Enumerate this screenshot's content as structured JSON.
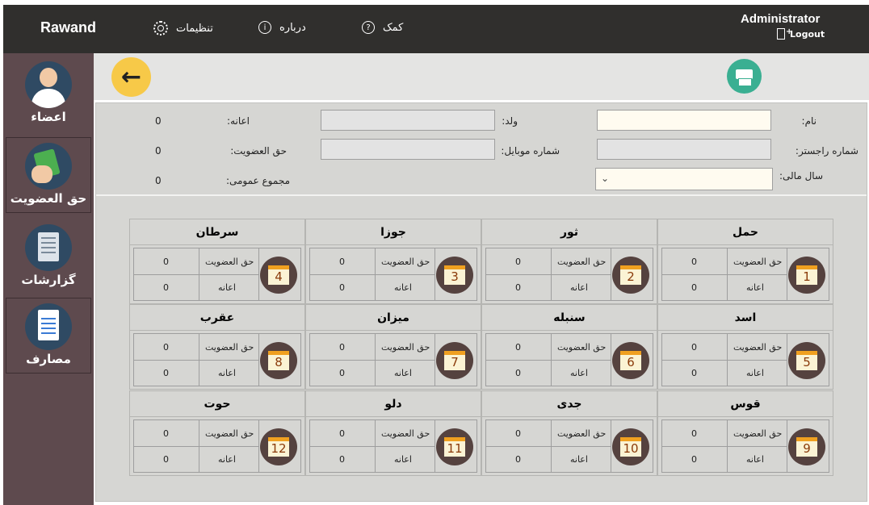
{
  "header": {
    "brand": "Rawand",
    "nav": [
      {
        "label": "تنظیمات",
        "icon": "gear-icon"
      },
      {
        "label": "درباره",
        "icon": "info-icon"
      },
      {
        "label": "کمک",
        "icon": "help-icon"
      }
    ],
    "user": "Administrator",
    "logout": "Logout"
  },
  "sidebar": {
    "items": [
      {
        "label": "اعضاء",
        "icon": "member-avatar-icon"
      },
      {
        "label": "حق العضویت",
        "icon": "money-hand-icon"
      },
      {
        "label": "گزارشات",
        "icon": "report-book-icon"
      },
      {
        "label": "مصارف",
        "icon": "expense-checklist-icon"
      }
    ]
  },
  "form": {
    "name_label": "نام:",
    "father_label": "ولد:",
    "donation_label": "اعانه:",
    "donation_value": "0",
    "reg_no_label": "شماره راجستر:",
    "mobile_label": "شماره موبایل:",
    "membership_label": "حق العضویت:",
    "membership_value": "0",
    "fiscal_year_label": "سال مالی:",
    "total_label": "مجموع عمومی:",
    "total_value": "0"
  },
  "months": [
    {
      "name": "حمل",
      "number": "1",
      "membership_label": "حق العضویت",
      "membership": "0",
      "donation_label": "اعانه",
      "donation": "0"
    },
    {
      "name": "ثور",
      "number": "2",
      "membership_label": "حق العضویت",
      "membership": "0",
      "donation_label": "اعانه",
      "donation": "0"
    },
    {
      "name": "جوزا",
      "number": "3",
      "membership_label": "حق العضویت",
      "membership": "0",
      "donation_label": "اعانه",
      "donation": "0"
    },
    {
      "name": "سرطان",
      "number": "4",
      "membership_label": "حق العضویت",
      "membership": "0",
      "donation_label": "اعانه",
      "donation": "0"
    },
    {
      "name": "اسد",
      "number": "5",
      "membership_label": "حق العضویت",
      "membership": "0",
      "donation_label": "اعانه",
      "donation": "0"
    },
    {
      "name": "سنبله",
      "number": "6",
      "membership_label": "حق العضویت",
      "membership": "0",
      "donation_label": "اعانه",
      "donation": "0"
    },
    {
      "name": "میزان",
      "number": "7",
      "membership_label": "حق العضویت",
      "membership": "0",
      "donation_label": "اعانه",
      "donation": "0"
    },
    {
      "name": "عقرب",
      "number": "8",
      "membership_label": "حق العضویت",
      "membership": "0",
      "donation_label": "اعانه",
      "donation": "0"
    },
    {
      "name": "قوس",
      "number": "9",
      "membership_label": "حق العضویت",
      "membership": "0",
      "donation_label": "اعانه",
      "donation": "0"
    },
    {
      "name": "جدی",
      "number": "10",
      "membership_label": "حق العضویت",
      "membership": "0",
      "donation_label": "اعانه",
      "donation": "0"
    },
    {
      "name": "دلو",
      "number": "11",
      "membership_label": "حق العضویت",
      "membership": "0",
      "donation_label": "اعانه",
      "donation": "0"
    },
    {
      "name": "حوت",
      "number": "12",
      "membership_label": "حق العضویت",
      "membership": "0",
      "donation_label": "اعانه",
      "donation": "0"
    }
  ],
  "colors": {
    "topbar": "#302f2d",
    "sidebar": "#5e4a4e",
    "back_button": "#f7c948",
    "print_button": "#3aaf92",
    "month_badge": "#55423f"
  }
}
